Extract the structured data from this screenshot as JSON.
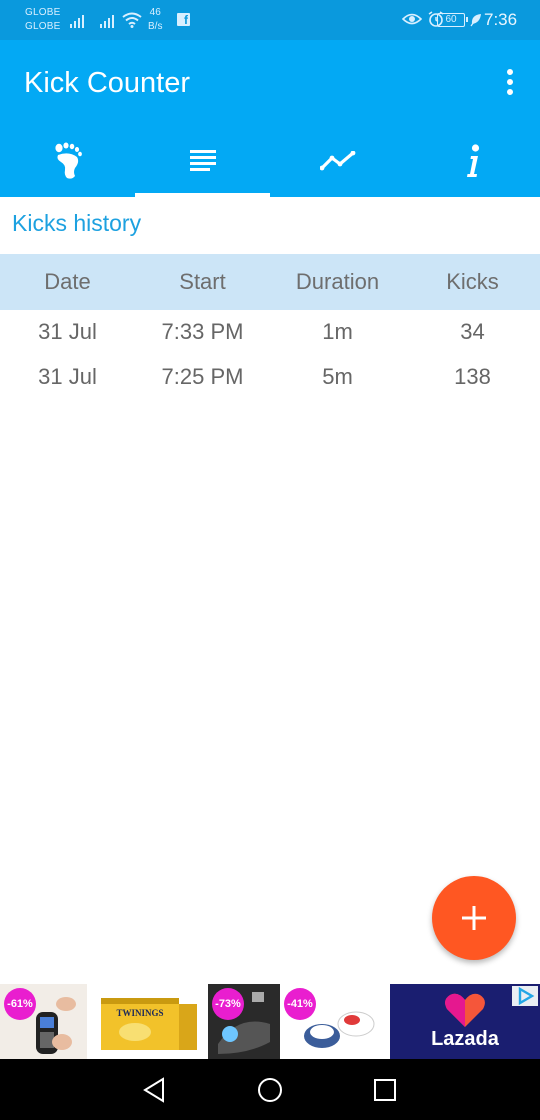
{
  "status_bar": {
    "carrier_1": "GLOBE",
    "carrier_2": "GLOBE",
    "speed_value": "46",
    "speed_unit": "B/s",
    "battery": "60",
    "time": "7:36"
  },
  "app_bar": {
    "title": "Kick Counter",
    "tabs": [
      {
        "icon": "foot-icon",
        "active": false
      },
      {
        "icon": "list-icon",
        "active": true
      },
      {
        "icon": "chart-icon",
        "active": false
      },
      {
        "icon": "info-icon",
        "active": false
      }
    ]
  },
  "history": {
    "section_title": "Kicks history",
    "columns": [
      "Date",
      "Start",
      "Duration",
      "Kicks"
    ],
    "rows": [
      [
        "31 Jul",
        "7:33 PM",
        "1m",
        "34"
      ],
      [
        "31 Jul",
        "7:25 PM",
        "5m",
        "138"
      ]
    ]
  },
  "fab": {
    "icon": "plus-icon"
  },
  "ad": {
    "discounts": [
      "-61%",
      "-73%",
      "-41%"
    ],
    "product_label": "TWININGS",
    "brand": "Lazada"
  },
  "colors": {
    "status_bar": "#0a99dd",
    "app_bar": "#03a9f4",
    "header_row": "#cce5f7",
    "section_title": "#1da1e0",
    "fab": "#ff5722"
  }
}
